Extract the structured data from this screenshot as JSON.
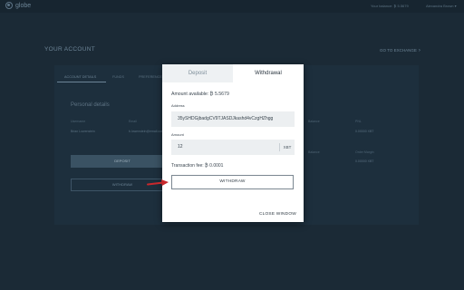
{
  "app": {
    "logo_text": "globe",
    "top_balance": "Your balance: ₿ 5.5679",
    "user_menu": "Alexandra Brown"
  },
  "account": {
    "title": "YOUR ACCOUNT",
    "go_exchange": "GO TO EXCHANGE",
    "tabs": [
      "ACCOUNT DETAILS",
      "FUNDS",
      "PREFERENCES"
    ],
    "personal_heading": "Personal details",
    "username_label": "Username",
    "username_value": "Brian Lowenstein",
    "email_label": "Email",
    "email_value": "b.lowenstein@email.com",
    "balance_label": "Balance",
    "pnl_label": "PNL",
    "pnl_value": "0.00000 XBT",
    "balance2_label": "Balance",
    "order_margin_label": "Order Margin",
    "order_margin_value": "0.00000 XBT",
    "deposit_label": "DEPOSIT",
    "withdraw_label": "WITHDRAW"
  },
  "modal": {
    "tabs": [
      "Deposit",
      "Withdrawal"
    ],
    "active_tab": "Withdrawal",
    "available": "Amount available: ₿ 5.5679",
    "address_label": "Address",
    "address_value": "35ySHDGjbadgCV9TJASDJkashd4vCzgHZhgg",
    "amount_label": "Amount",
    "amount_value": "12",
    "amount_unit": "XBT",
    "fee": "Transaction fee: ₿ 0.0001",
    "withdraw_button": "WITHDRAW",
    "close_button": "CLOSE WINDOW"
  },
  "colors": {
    "background": "#1b2a36",
    "modal": "#ffffff",
    "arrow": "#c8282c"
  },
  "icons": {
    "logo": "globe-logo-icon",
    "exchange_chevron": "chevron-right-icon",
    "user_chevron": "chevron-down-icon",
    "pointer": "red-arrow-icon"
  }
}
